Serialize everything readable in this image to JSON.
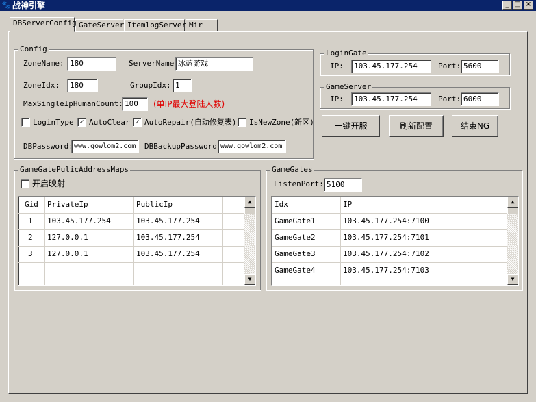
{
  "window": {
    "title": "战神引擎",
    "app_icon": "paw-icon"
  },
  "tabs": [
    {
      "label": "DBServerConfig"
    },
    {
      "label": "GateServer"
    },
    {
      "label": "ItemlogServer"
    },
    {
      "label": "Mir"
    }
  ],
  "config": {
    "legend": "Config",
    "zone_name_label": "ZoneName:",
    "zone_name": "180",
    "server_name_label": "ServerName:",
    "server_name": "冰蓝游戏",
    "zone_idx_label": "ZoneIdx:",
    "zone_idx": "180",
    "group_idx_label": "GroupIdx:",
    "group_idx": "1",
    "max_single_ip_label": "MaxSingleIpHumanCount:",
    "max_single_ip": "100",
    "max_single_ip_hint": "(单IP最大登陆人数)",
    "checkboxes": [
      {
        "label": "LoginType",
        "checked": false
      },
      {
        "label": "AutoClear",
        "checked": true
      },
      {
        "label": "AutoRepair(自动修复表)",
        "checked": true
      },
      {
        "label": "IsNewZone(新区)",
        "checked": false
      }
    ],
    "db_password_label": "DBPassword:",
    "db_password": "www.gowlom2.com",
    "db_backup_password_label": "DBBackupPassword:",
    "db_backup_password": "www.gowlom2.com"
  },
  "login_gate": {
    "legend": "LoginGate",
    "ip_label": "IP:",
    "ip": "103.45.177.254",
    "port_label": "Port:",
    "port": "5600"
  },
  "game_server": {
    "legend": "GameServer",
    "ip_label": "IP:",
    "ip": "103.45.177.254",
    "port_label": "Port:",
    "port": "6000"
  },
  "actions": {
    "one_click_open": "一键开服",
    "refresh_config": "刷新配置",
    "end_ng": "结束NG"
  },
  "public_maps": {
    "legend": "GameGatePulicAddressMaps",
    "enable_mapping_label": "开启映射",
    "enable_mapping_checked": false,
    "columns": [
      "Gid",
      "PrivateIp",
      "PublicIp"
    ],
    "rows": [
      [
        "1",
        "103.45.177.254",
        "103.45.177.254"
      ],
      [
        "2",
        "127.0.0.1",
        "103.45.177.254"
      ],
      [
        "3",
        "127.0.0.1",
        "103.45.177.254"
      ]
    ]
  },
  "game_gates": {
    "legend": "GameGates",
    "listen_port_label": "ListenPort:",
    "listen_port": "5100",
    "columns": [
      "Idx",
      "IP"
    ],
    "rows": [
      [
        "GameGate1",
        "103.45.177.254:7100"
      ],
      [
        "GameGate2",
        "103.45.177.254:7101"
      ],
      [
        "GameGate3",
        "103.45.177.254:7102"
      ],
      [
        "GameGate4",
        "103.45.177.254:7103"
      ]
    ]
  }
}
